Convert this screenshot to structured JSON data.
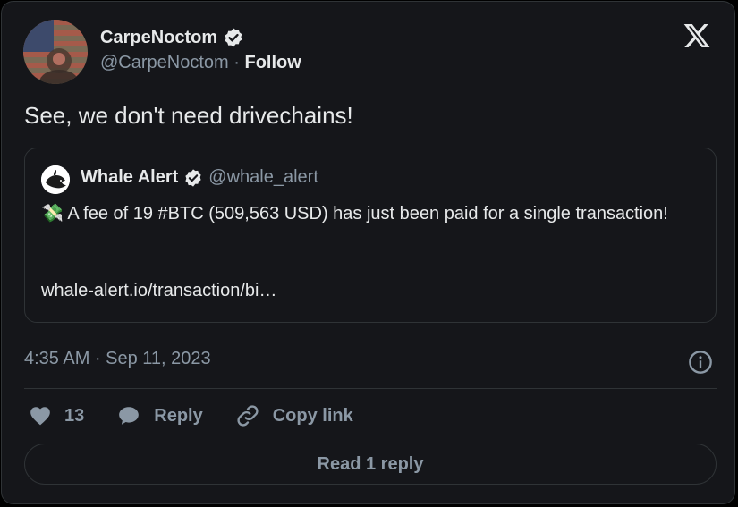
{
  "author": {
    "name": "CarpeNoctom",
    "handle": "@CarpeNoctom",
    "separator": "·",
    "follow_label": "Follow"
  },
  "tweet": {
    "text": "See, we don't need drivechains!"
  },
  "quoted": {
    "name": "Whale Alert",
    "handle": "@whale_alert",
    "emoji": "💸",
    "text": "A fee of 19 #BTC (509,563 USD) has just been paid for a single transaction!",
    "link": "whale-alert.io/transaction/bi…"
  },
  "meta": {
    "timestamp": "4:35 AM · Sep 11, 2023"
  },
  "actions": {
    "likes": "13",
    "reply_label": "Reply",
    "copy_label": "Copy link"
  },
  "footer": {
    "read_replies_label": "Read 1 reply"
  },
  "colors": {
    "background": "#15161a",
    "text": "#e7e9ea",
    "muted": "#8b98a5",
    "border": "#2f3336"
  }
}
